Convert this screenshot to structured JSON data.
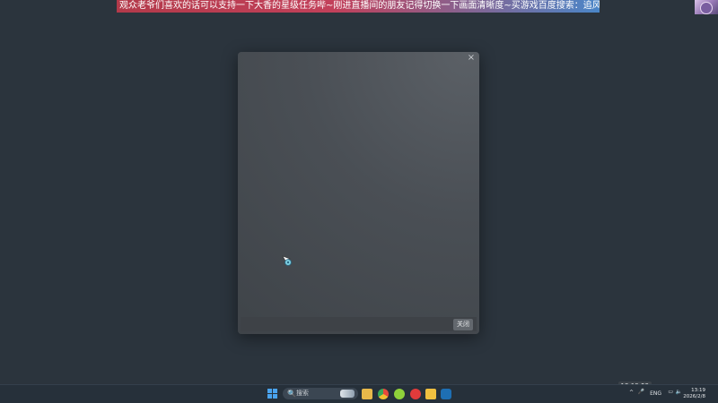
{
  "banner": {
    "text": "观众老爷们喜欢的话可以支持一下大香的星级任务哔~刚进直播间的朋友记得切换一下画面清晰度~买游戏百度搜索：追风蜗牛商城"
  },
  "dialog": {
    "close_glyph": "×",
    "footer_button_label": "关闭"
  },
  "taskbar": {
    "search_placeholder": "搜索",
    "search_icon_glyph": "🔍",
    "pinned_apps": [
      "windows-start",
      "file-explorer",
      "chrome",
      "chat-app",
      "netease-music",
      "wallet-app",
      "steam"
    ],
    "tray": {
      "overlay_time": "13:19:53",
      "language": "ENG",
      "clock_time": "13:19",
      "clock_date": "2026/2/8",
      "chevron_glyph": "^"
    }
  },
  "colors": {
    "desktop_bg": "#2b343d",
    "dialog_bg": "#4a4f55",
    "taskbar_bg": "#26303a",
    "start_blue": "#4aa3ee"
  }
}
